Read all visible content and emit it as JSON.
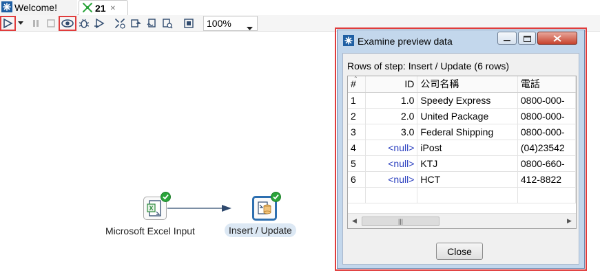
{
  "tabs": [
    {
      "label": "Welcome!",
      "icon": "spoon-icon",
      "active": false
    },
    {
      "label": "21",
      "icon": "transformation-icon",
      "active": true
    }
  ],
  "toolbar": {
    "zoom": "100%",
    "highlight_color": "#e03c3c"
  },
  "canvas": {
    "steps": [
      {
        "label": "Microsoft Excel Input",
        "icon": "excel-input-icon",
        "status": "ok"
      },
      {
        "label": "Insert / Update",
        "icon": "insert-update-icon",
        "status": "ok",
        "selected": true
      }
    ],
    "hop_color": "#2f4a6e",
    "ok_color": "#2aa43a"
  },
  "dialog": {
    "title": "Examine preview data",
    "rows_label": "Rows of step: Insert / Update (6 rows)",
    "columns": [
      "#",
      "ID",
      "公司名稱",
      "電話"
    ],
    "rows": [
      [
        "1",
        "1.0",
        "Speedy Express",
        "0800-000-"
      ],
      [
        "2",
        "2.0",
        "United Package",
        "0800-000-"
      ],
      [
        "3",
        "3.0",
        "Federal Shipping",
        "0800-000-"
      ],
      [
        "4",
        "<null>",
        "iPost",
        "(04)23542"
      ],
      [
        "5",
        "<null>",
        "KTJ",
        "0800-660-"
      ],
      [
        "6",
        "<null>",
        "HCT",
        "412-8822"
      ]
    ],
    "close_label": "Close",
    "null_color": "#2a3fbf"
  }
}
